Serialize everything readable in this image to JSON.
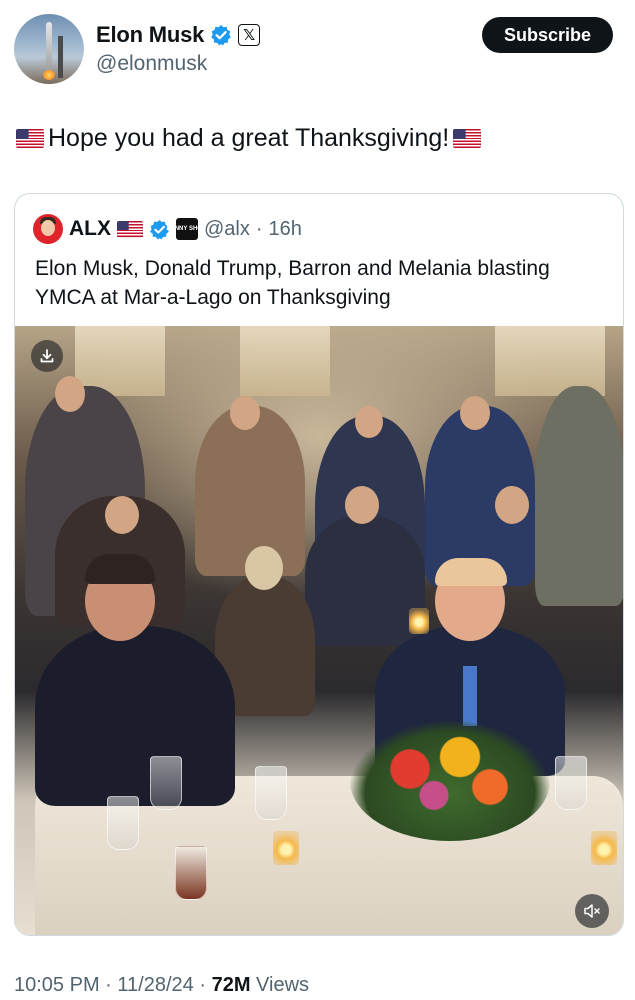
{
  "author": {
    "display_name": "Elon Musk",
    "handle": "@elonmusk",
    "subscribe_label": "Subscribe",
    "avatar_icon": "starship-launch-avatar",
    "verified_icon": "verified-badge-icon",
    "platform_badge_icon": "x-logo-icon",
    "verified_color": "#1d9bf0"
  },
  "tweet": {
    "text": "Hope you had a great Thanksgiving!",
    "emoji_icon": "us-flag-emoji"
  },
  "quoted_tweet": {
    "display_name": "ALX",
    "handle": "@alx",
    "separator": "·",
    "time_ago": "16h",
    "logo_text": "BENNY SHOW",
    "text": "Elon Musk, Donald Trump, Barron and Melania blasting YMCA at Mar-a-Lago on Thanksgiving",
    "media": {
      "type": "video",
      "download_icon": "download-icon",
      "mute_icon": "muted-speaker-icon"
    }
  },
  "footer": {
    "time": "10:05 PM",
    "separator": "·",
    "date": "11/28/24",
    "views_count": "72M",
    "views_label": "Views"
  },
  "colors": {
    "text_primary": "#0f1419",
    "text_secondary": "#536471",
    "border": "#cfd9de",
    "button_bg": "#0f1419"
  }
}
